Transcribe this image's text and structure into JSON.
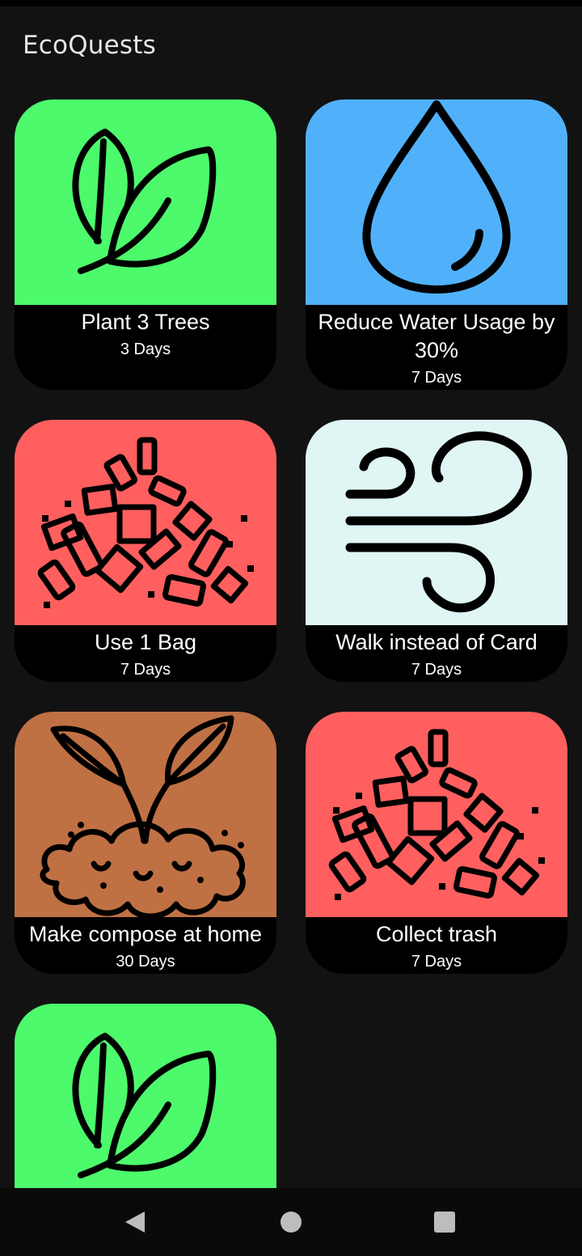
{
  "app": {
    "title": "EcoQuests"
  },
  "colors": {
    "green": "#4cfa6c",
    "blue": "#50b1fa",
    "red": "#ff5f5f",
    "mint": "#e0f6f4",
    "brown": "#c07144",
    "background": "#121212"
  },
  "quests": [
    {
      "title": "Plant 3 Trees",
      "duration": "3 Days",
      "icon": "leaf-icon",
      "color": "#4cfa6c"
    },
    {
      "title": "Reduce Water Usage by 30%",
      "duration": "7 Days",
      "icon": "water-drop-icon",
      "color": "#50b1fa"
    },
    {
      "title": "Use 1 Bag",
      "duration": "7 Days",
      "icon": "trash-pile-icon",
      "color": "#ff5f5f"
    },
    {
      "title": "Walk instead of Card",
      "duration": "7 Days",
      "icon": "wind-icon",
      "color": "#e0f6f4"
    },
    {
      "title": "Make compose at home",
      "duration": "30 Days",
      "icon": "sprout-soil-icon",
      "color": "#c07144"
    },
    {
      "title": "Collect trash",
      "duration": "7 Days",
      "icon": "trash-pile-icon",
      "color": "#ff5f5f"
    },
    {
      "title": "",
      "duration": "",
      "icon": "leaf-icon",
      "color": "#4cfa6c"
    }
  ],
  "navigation": {
    "back": "back-icon",
    "home": "home-icon",
    "recents": "recents-icon"
  }
}
